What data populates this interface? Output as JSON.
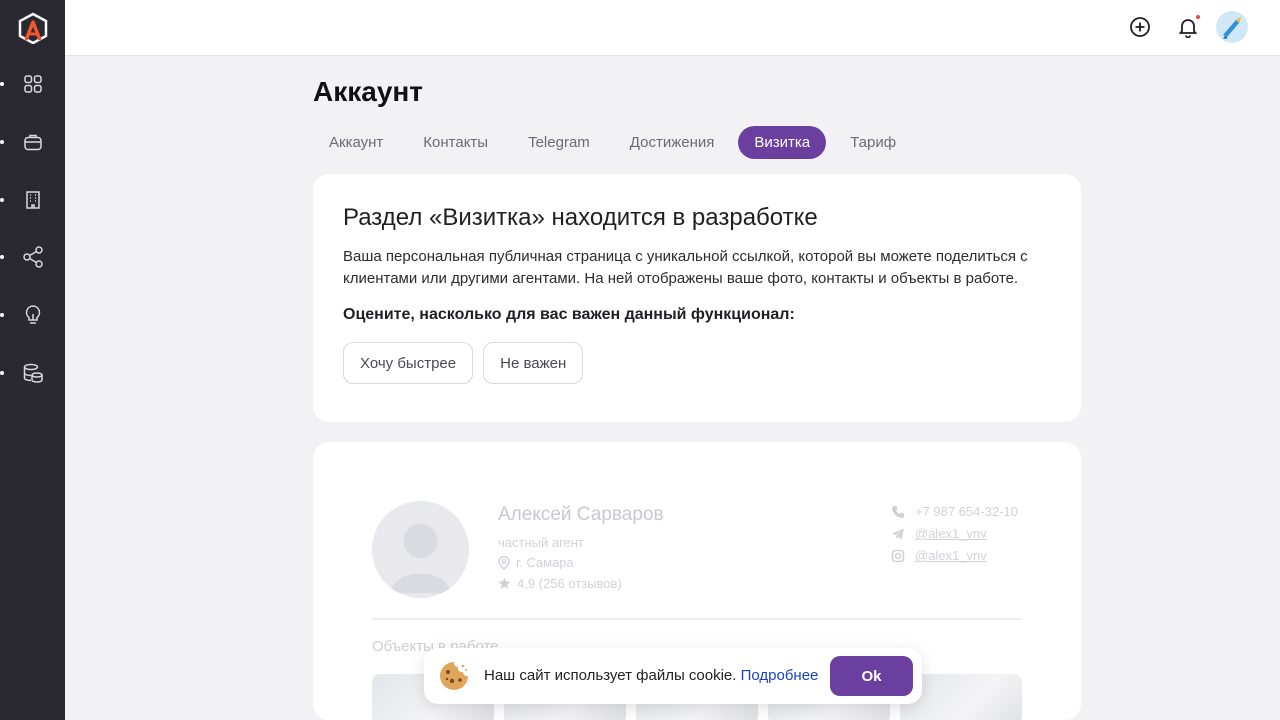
{
  "colors": {
    "sidebar": "#2a2830",
    "accent": "#6a3fa0",
    "link": "#1a3fd0",
    "background": "#f2f2f4"
  },
  "sidebar": {
    "logo": "logo-icon",
    "items": [
      {
        "icon": "apps-grid-icon"
      },
      {
        "icon": "briefcase-icon"
      },
      {
        "icon": "building-icon"
      },
      {
        "icon": "share-icon"
      },
      {
        "icon": "lightbulb-icon"
      },
      {
        "icon": "database-icon"
      }
    ]
  },
  "header": {
    "add_icon": "plus-circle-icon",
    "bell_icon": "bell-icon",
    "has_notification": true
  },
  "page": {
    "title": "Аккаунт"
  },
  "tabs": [
    {
      "label": "Аккаунт",
      "active": false
    },
    {
      "label": "Контакты",
      "active": false
    },
    {
      "label": "Telegram",
      "active": false
    },
    {
      "label": "Достижения",
      "active": false
    },
    {
      "label": "Визитка",
      "active": true
    },
    {
      "label": "Тариф",
      "active": false
    }
  ],
  "notice": {
    "title": "Раздел «Визитка» находится в разработке",
    "text": "Ваша персональная публичная страница с уникальной ссылкой, которой вы можете поделиться с клиентами или другими агентами. На ней отображены ваше фото, контакты и объекты в работе.",
    "question": "Оцените, насколько для вас важен данный функционал:",
    "choices": [
      "Хочу быстрее",
      "Не важен"
    ]
  },
  "preview": {
    "name": "Алексей Сарваров",
    "role": "частный агент",
    "city": "г. Самара",
    "rating": "4,9 (256 отзывов)",
    "phone": "+7 987 654-32-10",
    "telegram": "@alex1_vnv",
    "instagram": "@alex1_vnv",
    "objects_title": "Объекты в работе"
  },
  "cookie": {
    "text": "Наш сайт использует файлы cookie.",
    "link": "Подробнее",
    "ok": "Ok"
  }
}
